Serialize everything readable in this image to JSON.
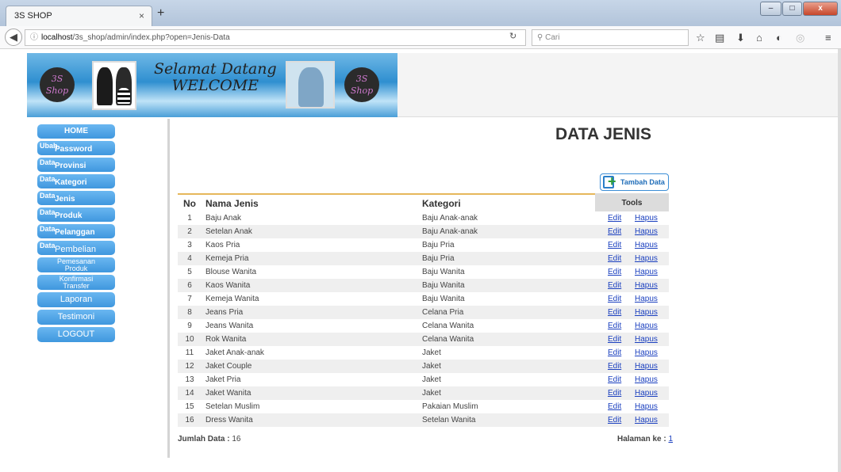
{
  "browser": {
    "tab_title": "3S SHOP",
    "tab_close": "×",
    "new_tab": "+",
    "url_host": "localhost",
    "url_path": "/3s_shop/admin/index.php?open=Jenis-Data",
    "search_placeholder": "Cari",
    "info_symbol": "ⓘ",
    "search_symbol": "⚲"
  },
  "banner": {
    "logo_text_1": "3S",
    "logo_text_2": "Shop",
    "welcome_line1": "Selamat Datang",
    "welcome_line2": "WELCOME"
  },
  "sidebar": {
    "home": "HOME",
    "items_two_part": [
      {
        "small": "Ubah",
        "big": "Password"
      },
      {
        "small": "Data",
        "big": "Provinsi"
      },
      {
        "small": "Data",
        "big": "Kategori"
      },
      {
        "small": "Data",
        "big": "Jenis"
      },
      {
        "small": "Data",
        "big": "Produk"
      },
      {
        "small": "Data",
        "big": "Pelanggan"
      },
      {
        "small": "Data",
        "big": "Pembelian"
      }
    ],
    "pemesanan": [
      "Pemesanan",
      "Produk"
    ],
    "konfirmasi": [
      "Konfirmasi",
      "Transfer"
    ],
    "laporan": "Laporan",
    "testimoni": "Testimoni",
    "logout": "LOGOUT"
  },
  "main": {
    "title": "DATA JENIS",
    "add_button": "Tambah Data",
    "columns": {
      "no": "No",
      "nama": "Nama Jenis",
      "kategori": "Kategori",
      "tools": "Tools"
    },
    "edit_label": "Edit",
    "hapus_label": "Hapus",
    "rows": [
      {
        "no": "1",
        "nama": "Baju Anak",
        "kategori": "Baju Anak-anak"
      },
      {
        "no": "2",
        "nama": "Setelan Anak",
        "kategori": "Baju Anak-anak"
      },
      {
        "no": "3",
        "nama": "Kaos Pria",
        "kategori": "Baju Pria"
      },
      {
        "no": "4",
        "nama": "Kemeja Pria",
        "kategori": "Baju Pria"
      },
      {
        "no": "5",
        "nama": "Blouse Wanita",
        "kategori": "Baju Wanita"
      },
      {
        "no": "6",
        "nama": "Kaos Wanita",
        "kategori": "Baju Wanita"
      },
      {
        "no": "7",
        "nama": "Kemeja Wanita",
        "kategori": "Baju Wanita"
      },
      {
        "no": "8",
        "nama": "Jeans Pria",
        "kategori": "Celana Pria"
      },
      {
        "no": "9",
        "nama": "Jeans Wanita",
        "kategori": "Celana Wanita"
      },
      {
        "no": "10",
        "nama": "Rok Wanita",
        "kategori": "Celana Wanita"
      },
      {
        "no": "11",
        "nama": "Jaket Anak-anak",
        "kategori": "Jaket"
      },
      {
        "no": "12",
        "nama": "Jaket Couple",
        "kategori": "Jaket"
      },
      {
        "no": "13",
        "nama": "Jaket Pria",
        "kategori": "Jaket"
      },
      {
        "no": "14",
        "nama": "Jaket Wanita",
        "kategori": "Jaket"
      },
      {
        "no": "15",
        "nama": "Setelan Muslim",
        "kategori": "Pakaian Muslim"
      },
      {
        "no": "16",
        "nama": "Dress Wanita",
        "kategori": "Setelan Wanita"
      }
    ],
    "jumlah_label": "Jumlah Data :",
    "jumlah_value": "16",
    "halaman_label": "Halaman ke :",
    "halaman_value": "1"
  },
  "colors": {
    "menu_blue": "#4aa3e8",
    "header_accent": "#e6b75b",
    "link": "#1a3fbf"
  }
}
